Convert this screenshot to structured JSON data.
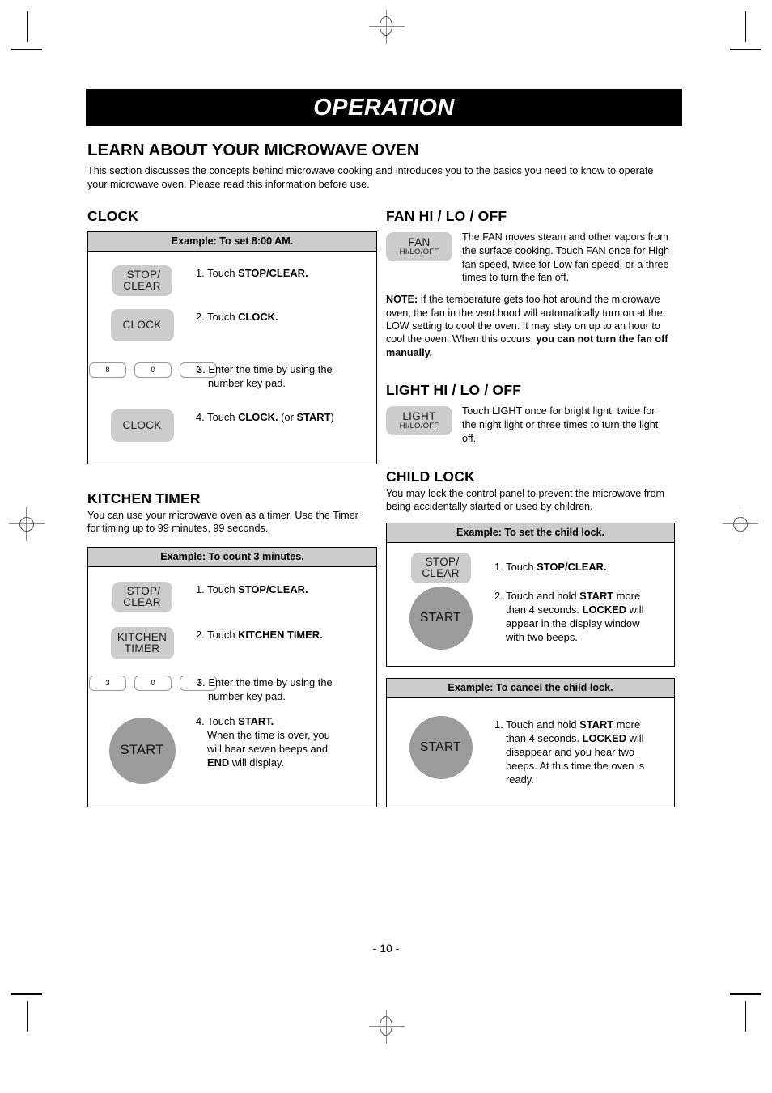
{
  "header": {
    "banner_title": "OPERATION"
  },
  "intro": {
    "heading": "LEARN ABOUT YOUR MICROWAVE OVEN",
    "text": "This section discusses the concepts behind microwave cooking and introduces you to the basics you need to know to operate your microwave oven. Please read this information before use."
  },
  "clock": {
    "heading": "CLOCK",
    "example_title": "Example: To set 8:00 AM.",
    "steps": [
      {
        "num": "1.",
        "text": "Touch ",
        "bold": "STOP/CLEAR.",
        "button": "STOP/CLEAR"
      },
      {
        "num": "2.",
        "text": "Touch ",
        "bold": "CLOCK.",
        "button": "CLOCK"
      },
      {
        "num": "3.",
        "text": "Enter the time by using the",
        "line2": "number key pad.",
        "keys": [
          "8",
          "0",
          "0"
        ]
      },
      {
        "num": "4.",
        "text": "Touch ",
        "bold": "CLOCK.",
        "tail": " (or ",
        "bold2": "START",
        "tail2": ")",
        "button": "CLOCK"
      }
    ],
    "buttons": {
      "stop_clear_line1": "STOP/",
      "stop_clear_line2": "CLEAR",
      "clock_label": "CLOCK"
    }
  },
  "kitchen_timer": {
    "heading": "KITCHEN TIMER",
    "description": "You can use your microwave oven as a timer. Use the Timer for timing up to 99 minutes, 99 seconds.",
    "example_title": "Example: To count 3 minutes.",
    "steps": [
      {
        "num": "1.",
        "text": "Touch ",
        "bold": "STOP/CLEAR."
      },
      {
        "num": "2.",
        "text": "Touch ",
        "bold": "KITCHEN TIMER."
      },
      {
        "num": "3.",
        "text": "Enter the time by using the",
        "line2": "number key pad.",
        "keys": [
          "3",
          "0",
          "0"
        ]
      },
      {
        "num": "4.",
        "text": "Touch ",
        "bold": "START.",
        "line2": "When the time is over, you",
        "line3": "will hear seven beeps and",
        "line4_bold": "END",
        "line4": " will display."
      }
    ],
    "buttons": {
      "stop_clear_line1": "STOP/",
      "stop_clear_line2": "CLEAR",
      "kitchen_line1": "KITCHEN",
      "kitchen_line2": "TIMER",
      "start_label": "START"
    }
  },
  "fan": {
    "heading": "FAN HI / LO / OFF",
    "button_line1": "FAN",
    "button_line2": "HI/LO/OFF",
    "text": "The FAN moves steam and other vapors  from the surface cooking. Touch FAN once for High fan speed, twice for Low fan speed, or a three times to turn the fan off.",
    "note_label": "NOTE:",
    "note_text": " If the temperature gets too hot around the microwave oven, the fan in the vent hood will automatically turn on at the LOW setting to cool the oven. It may stay on up to an hour to cool the oven. When this occurs, ",
    "note_bold": "you can not turn the fan off manually."
  },
  "light": {
    "heading": "LIGHT HI / LO / OFF",
    "button_line1": "LIGHT",
    "button_line2": "HI/LO/OFF",
    "text": "Touch LIGHT once for bright light, twice for the night light or three times to turn the light off."
  },
  "child_lock": {
    "heading": "CHILD LOCK",
    "description": "You may lock the control panel to prevent the microwave from being accidentally started or used by children.",
    "set_example_title": "Example: To set the child lock.",
    "set_steps": [
      {
        "num": "1.",
        "text": "Touch ",
        "bold": "STOP/CLEAR."
      },
      {
        "num": "2.",
        "text": "Touch and hold ",
        "bold": "START",
        "tail": " more",
        "line2": "than 4 seconds. ",
        "line2_bold": "LOCKED",
        "line2_tail": " will",
        "line3": "appear in the display window",
        "line4": "with two beeps."
      }
    ],
    "cancel_example_title": "Example: To cancel the child lock.",
    "cancel_steps": [
      {
        "num": "1.",
        "text": "Touch and hold ",
        "bold": "START",
        "tail": " more",
        "line2": "than 4 seconds. ",
        "line2_bold": "LOCKED",
        "line2_tail": " will",
        "line3": "disappear and you hear two",
        "line4": "beeps. At this time the oven is",
        "line5": "ready."
      }
    ],
    "buttons": {
      "stop_clear_line1": "STOP/",
      "stop_clear_line2": "CLEAR",
      "start_label": "START"
    }
  },
  "footer": {
    "page_number": "- 10 -"
  },
  "colors": {
    "banner_bg": "#000000",
    "example_header_bg": "#cccccc",
    "button_fill": "#cccccc",
    "start_fill": "#9b9b9b"
  }
}
